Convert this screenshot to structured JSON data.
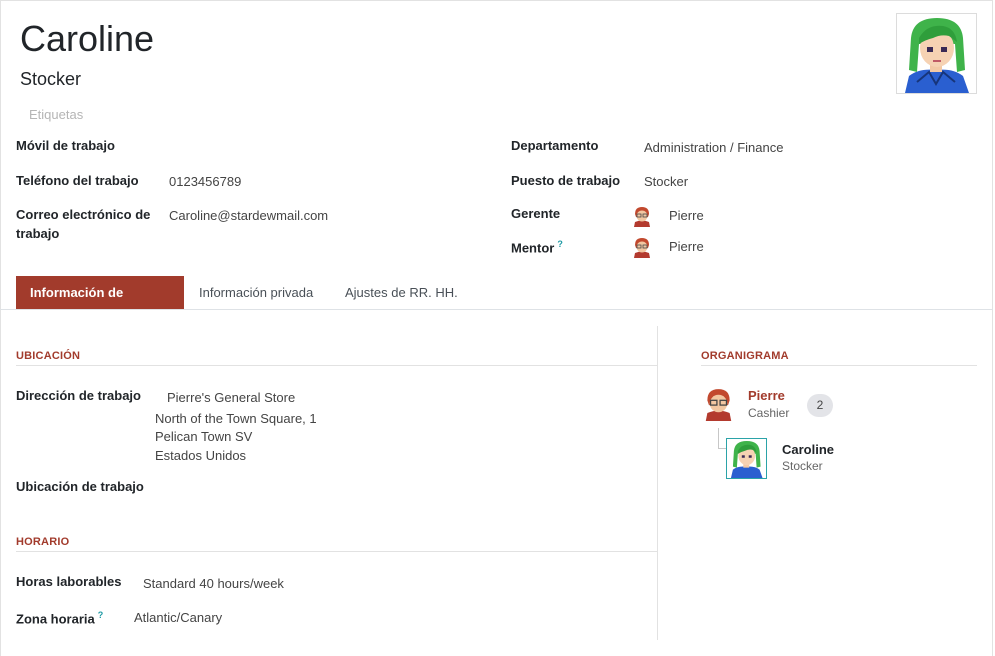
{
  "header": {
    "name": "Caroline",
    "job_title": "Stocker",
    "tags_placeholder": "Etiquetas"
  },
  "fields_left": {
    "mobile_label": "Móvil de trabajo",
    "mobile_value": "",
    "phone_label": "Teléfono del trabajo",
    "phone_value": "0123456789",
    "email_label_line1": "Correo electrónico de",
    "email_label_line2": "trabajo",
    "email_value": "Caroline@stardewmail.com"
  },
  "fields_right": {
    "department_label": "Departamento",
    "department_value": "Administration / Finance",
    "position_label": "Puesto de trabajo",
    "position_value": "Stocker",
    "manager_label": "Gerente",
    "manager_value": "Pierre",
    "mentor_label": "Mentor",
    "mentor_help": "?",
    "mentor_value": "Pierre"
  },
  "tabs": [
    {
      "label": "Información de trabajo",
      "active": true
    },
    {
      "label": "Información privada",
      "active": false
    },
    {
      "label": "Ajustes de RR. HH.",
      "active": false
    }
  ],
  "location": {
    "section_title": "UBICACIÓN",
    "address_label": "Dirección de trabajo",
    "address_line1": "Pierre's General Store",
    "address_line2": "North of the Town Square, 1",
    "address_line3": "Pelican Town SV",
    "address_line4": "Estados Unidos",
    "work_location_label": "Ubicación de trabajo",
    "work_location_value": ""
  },
  "schedule": {
    "section_title": "HORARIO",
    "hours_label": "Horas laborables",
    "hours_value": "Standard 40 hours/week",
    "timezone_label": "Zona horaria",
    "timezone_help": "?",
    "timezone_value": "Atlantic/Canary"
  },
  "org_chart": {
    "section_title": "ORGANIGRAMA",
    "manager_name": "Pierre",
    "manager_title": "Cashier",
    "manager_count": "2",
    "employee_name": "Caroline",
    "employee_title": "Stocker"
  },
  "colors": {
    "accent": "#a23b2c",
    "help": "#1f9aa5"
  }
}
